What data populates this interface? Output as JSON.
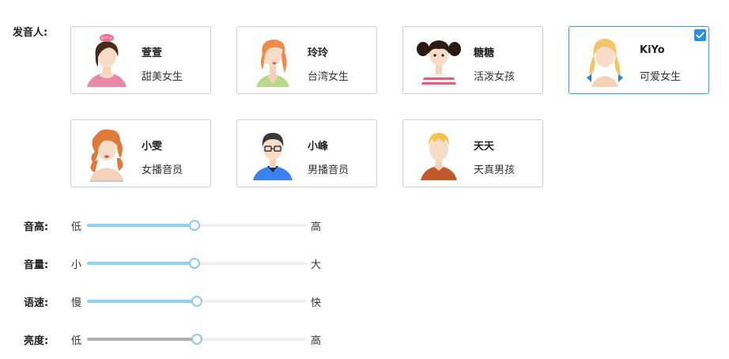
{
  "speaker_label": "发音人:",
  "voices": [
    {
      "name": "萱萱",
      "desc": "甜美女生",
      "icon": "girl-pink-bow-avatar",
      "selected": false
    },
    {
      "name": "玲玲",
      "desc": "台湾女生",
      "icon": "girl-orange-hair-avatar",
      "selected": false
    },
    {
      "name": "糖糖",
      "desc": "活泼女孩",
      "icon": "girl-pigtails-avatar",
      "selected": false
    },
    {
      "name": "KiYo",
      "desc": "可爱女生",
      "icon": "girl-blonde-braids-avatar",
      "selected": true
    },
    {
      "name": "小雯",
      "desc": "女播音员",
      "icon": "woman-curly-hair-avatar",
      "selected": false
    },
    {
      "name": "小峰",
      "desc": "男播音员",
      "icon": "man-glasses-avatar",
      "selected": false
    },
    {
      "name": "天天",
      "desc": "天真男孩",
      "icon": "boy-blonde-avatar",
      "selected": false
    }
  ],
  "sliders": [
    {
      "label": "音高:",
      "min_label": "低",
      "max_label": "高",
      "value": 0.49,
      "fill_color": "#8cd0f2"
    },
    {
      "label": "音量:",
      "min_label": "小",
      "max_label": "大",
      "value": 0.49,
      "fill_color": "#8cd0f2"
    },
    {
      "label": "语速:",
      "min_label": "慢",
      "max_label": "快",
      "value": 0.5,
      "fill_color": "#8cd0f2"
    },
    {
      "label": "亮度:",
      "min_label": "低",
      "max_label": "高",
      "value": 0.5,
      "fill_color": "#b0b0b0"
    }
  ],
  "colors": {
    "accent": "#2b8fe0",
    "selected_border": "#3a9ad9"
  }
}
